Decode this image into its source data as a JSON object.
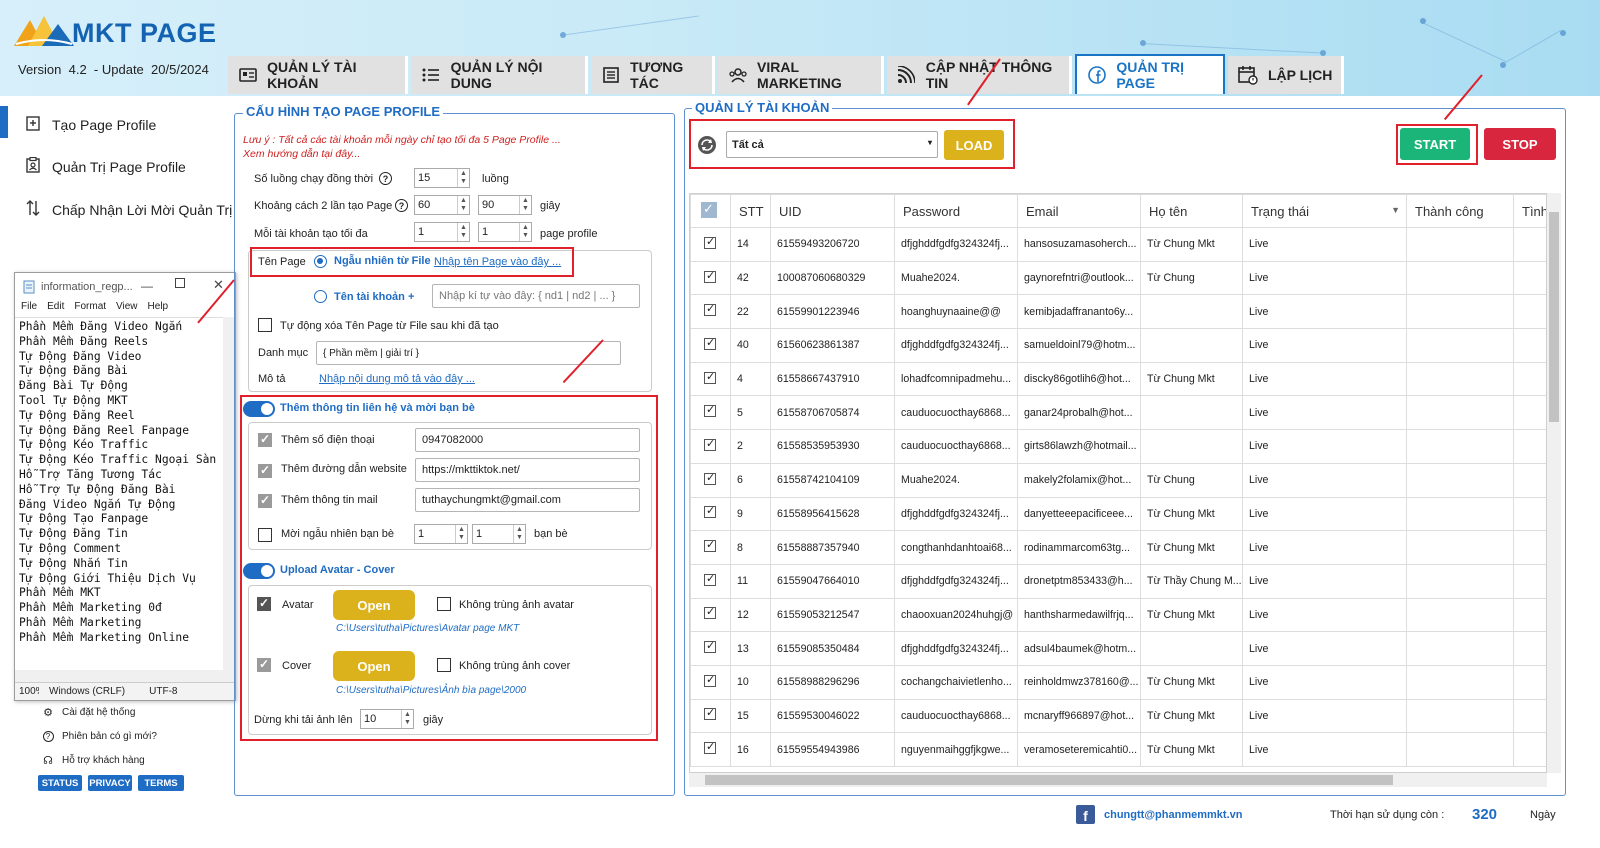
{
  "app": {
    "logo_text": "MKT PAGE",
    "version_label": "Version",
    "version": "4.2",
    "update_label": "- Update",
    "update_date": "20/5/2024"
  },
  "tabs": [
    {
      "label": "QUẢN LÝ TÀI KHOẢN",
      "icon": "id-card-icon",
      "active": false
    },
    {
      "label": "QUẢN LÝ NỘI DUNG",
      "icon": "list-icon",
      "active": false
    },
    {
      "label": "TƯƠNG TÁC",
      "icon": "document-icon",
      "active": false
    },
    {
      "label": "VIRAL MARKETING",
      "icon": "users-icon",
      "active": false
    },
    {
      "label": "CẬP NHẬT THÔNG TIN",
      "icon": "rss-icon",
      "active": false
    },
    {
      "label": "QUẢN TRỊ PAGE",
      "icon": "facebook-icon",
      "active": true
    },
    {
      "label": "LẬP LỊCH",
      "icon": "calendar-icon",
      "active": false
    }
  ],
  "sidebar": {
    "items": [
      {
        "label": "Tạo Page Profile",
        "icon": "add-page-icon"
      },
      {
        "label": "Quản Trị Page Profile",
        "icon": "clipboard-user-icon"
      },
      {
        "label": "Chấp Nhận Lời Mời Quản Trị",
        "icon": "sort-arrows-icon"
      }
    ],
    "bottom_links": [
      {
        "label": "Cài đặt hệ thống",
        "icon": "gear-icon"
      },
      {
        "label": "Phiên bản có gì mới?",
        "icon": "question-icon"
      },
      {
        "label": "Hỗ trợ khách hàng",
        "icon": "headset-icon"
      }
    ],
    "buttons": [
      "STATUS",
      "PRIVACY",
      "TERMS"
    ]
  },
  "notepad": {
    "title": "information_regp...",
    "menu": [
      "File",
      "Edit",
      "Format",
      "View",
      "Help"
    ],
    "lines": [
      "Phần Mềm Đăng Video Ngắn",
      "Phần Mềm Đăng Reels",
      "Tự Động Đăng Video",
      "Tự Động Đăng Bài",
      "Đăng Bài Tự Động",
      "Tool Tự Động MKT",
      "Tự Động Đăng Reel",
      "Tự Động Đăng Reel Fanpage",
      "Tự Động Kéo Traffic",
      "Tự Động Kéo Traffic Ngoại Sàn",
      "Hỗ Trợ Tăng Tương Tác",
      "Hỗ Trợ Tự Động Đăng Bài",
      "Đăng Video Ngắn Tự Động",
      "Tự Động Tạo Fanpage",
      "Tự Động Đăng Tin",
      "Tự Động Comment",
      "Tự Động Nhắn Tin",
      "Tự Động Giới Thiệu Dịch Vụ",
      "Phần Mềm MKT",
      "Phần Mềm Marketing 0đ",
      "Phần Mềm Marketing",
      "Phần Mềm Marketing Online"
    ],
    "status_zoom": "100%",
    "status_eol": "Windows (CRLF)",
    "status_enc": "UTF-8"
  },
  "config": {
    "title": "CẤU HÌNH TẠO PAGE PROFILE",
    "note_line1": "Lưu ý : Tất cả các tài khoản mỗi ngày chỉ tạo tối đa 5 Page Profile ...",
    "note_line2": "Xem hướng dẫn tại đây...",
    "threads_label": "Số luồng chạy đồng thời",
    "threads_value": "15",
    "threads_unit": "luồng",
    "interval_label": "Khoảng cách 2 lần tạo Page",
    "interval_min": "60",
    "interval_max": "90",
    "interval_unit": "giây",
    "max_label": "Mỗi tài khoản tạo tối đa",
    "max_min": "1",
    "max_max": "1",
    "max_unit": "page profile",
    "pagename_label": "Tên Page",
    "radio_random": "Ngẫu nhiên từ File",
    "radio_random_link": "Nhập tên Page vào đây ...",
    "radio_account": "Tên tài khoản +",
    "account_suffix_placeholder": "Nhập kí tự vào đây: { nd1 | nd2 | ... }",
    "auto_delete_label": "Tự động xóa Tên Page từ File sau khi đã tạo",
    "category_label": "Danh mục",
    "category_value": "{ Phần mềm | giải trí }",
    "desc_label": "Mô tả",
    "desc_link": "Nhập nội dung mô tả vào đây ...",
    "contact_toggle": "Thêm thông tin liên hệ và mời bạn bè",
    "phone_label": "Thêm số điện thoại",
    "phone_value": "0947082000",
    "website_label": "Thêm đường dẫn website",
    "website_value": "https://mkttiktok.net/",
    "mail_label": "Thêm thông tin mail",
    "mail_value": "tuthaychungmkt@gmail.com",
    "invite_label": "Mời ngẫu nhiên bạn bè",
    "invite_min": "1",
    "invite_max": "1",
    "invite_unit": "bạn bè",
    "upload_toggle": "Upload Avatar - Cover",
    "avatar_label": "Avatar",
    "open_label": "Open",
    "avatar_unique": "Không trùng ảnh avatar",
    "avatar_path": "C:\\Users\\tutha\\Pictures\\Avatar page MKT",
    "cover_label": "Cover",
    "cover_unique": "Không trùng ảnh cover",
    "cover_path": "C:\\Users\\tutha\\Pictures\\Ảnh bìa page\\2000",
    "stop_label": "Dừng khi tải ảnh lên",
    "stop_value": "10",
    "stop_unit": "giây"
  },
  "accounts": {
    "title": "QUẢN LÝ TÀI KHOẢN",
    "filter_value": "Tất cả",
    "load_label": "LOAD",
    "start_label": "START",
    "stop_label": "STOP",
    "columns": [
      "STT",
      "UID",
      "Password",
      "Email",
      "Họ tên",
      "Trạng thái",
      "Thành công",
      "Tình"
    ],
    "rows": [
      {
        "stt": "14",
        "uid": "61559493206720",
        "password": "dfjghddfgdfg324324fj...",
        "email": "hansosuzamasoherch...",
        "name": "Từ Chung Mkt",
        "status": "Live"
      },
      {
        "stt": "42",
        "uid": "100087060680329",
        "password": "Muahe2024.",
        "email": "gaynorefntri@outlook...",
        "name": "Từ Chung",
        "status": "Live"
      },
      {
        "stt": "22",
        "uid": "61559901223946",
        "password": "hoanghuynaaine@@",
        "email": "kemibjadaffrananto6y...",
        "name": "",
        "status": "Live"
      },
      {
        "stt": "40",
        "uid": "61560623861387",
        "password": "dfjghddfgdfg324324fj...",
        "email": "samueldoinl79@hotm...",
        "name": "",
        "status": "Live"
      },
      {
        "stt": "4",
        "uid": "61558667437910",
        "password": "lohadfcomnipadmehu...",
        "email": "discky86gotlih6@hot...",
        "name": "Từ Chung Mkt",
        "status": "Live"
      },
      {
        "stt": "5",
        "uid": "61558706705874",
        "password": "cauduocuocthay6868...",
        "email": "ganar24probalh@hot...",
        "name": "",
        "status": "Live"
      },
      {
        "stt": "2",
        "uid": "61558535953930",
        "password": "cauduocuocthay6868...",
        "email": "girts86lawzh@hotmail...",
        "name": "",
        "status": "Live"
      },
      {
        "stt": "6",
        "uid": "61558742104109",
        "password": "Muahe2024.",
        "email": "makely2folamix@hot...",
        "name": "Từ Chung",
        "status": "Live"
      },
      {
        "stt": "9",
        "uid": "61558956415628",
        "password": "dfjghddfgdfg324324fj...",
        "email": "danyetteeepacificeee...",
        "name": "Từ Chung Mkt",
        "status": "Live"
      },
      {
        "stt": "8",
        "uid": "61558887357940",
        "password": "congthanhdanhtoai68...",
        "email": "rodinammarcom63tg...",
        "name": "Từ Chung Mkt",
        "status": "Live"
      },
      {
        "stt": "11",
        "uid": "61559047664010",
        "password": "dfjghddfgdfg324324fj...",
        "email": "dronetptm853433@h...",
        "name": "Từ Thầy Chung M...",
        "status": "Live"
      },
      {
        "stt": "12",
        "uid": "61559053212547",
        "password": "chaooxuan2024huhgj@",
        "email": "hanthsharmedawilfrjq...",
        "name": "Từ Chung Mkt",
        "status": "Live"
      },
      {
        "stt": "13",
        "uid": "61559085350484",
        "password": "dfjghddfgdfg324324fj...",
        "email": "adsul4baumek@hotm...",
        "name": "",
        "status": "Live"
      },
      {
        "stt": "10",
        "uid": "61558988296296",
        "password": "cochangchaivietlenho...",
        "email": "reinholdmwz378160@...",
        "name": "Từ Chung Mkt",
        "status": "Live"
      },
      {
        "stt": "15",
        "uid": "61559530046022",
        "password": "cauduocuocthay6868...",
        "email": "mcnaryff966897@hot...",
        "name": "Từ Chung Mkt",
        "status": "Live"
      },
      {
        "stt": "16",
        "uid": "61559554943986",
        "password": "nguyenmaihggfjkgwe...",
        "email": "veramoseteremicahti0...",
        "name": "Từ Chung Mkt",
        "status": "Live"
      }
    ]
  },
  "footer": {
    "email": "chungtt@phanmemmkt.vn",
    "expiry_label": "Thời hạn sử dụng còn :",
    "expiry_value": "320",
    "expiry_unit": "Ngày"
  }
}
